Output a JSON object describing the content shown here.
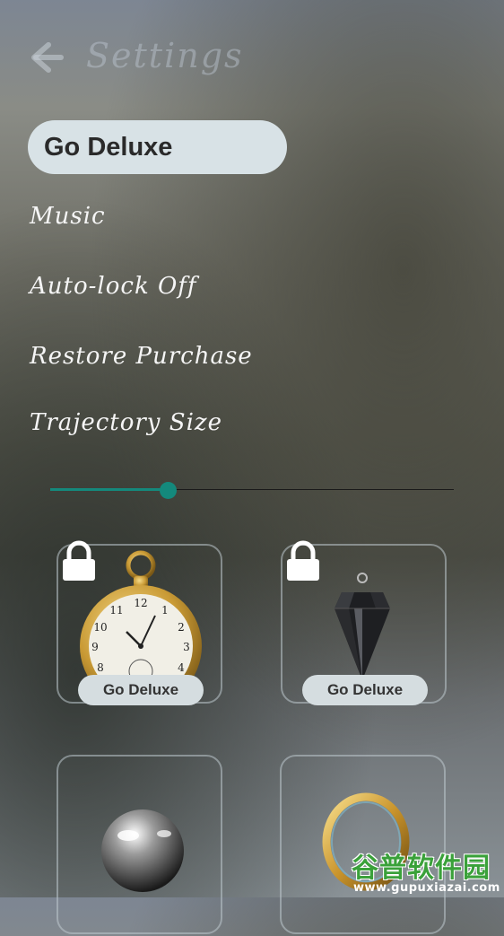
{
  "header": {
    "title": "Settings",
    "back_icon": "arrow-left-icon"
  },
  "deluxe_button": {
    "label": "Go Deluxe"
  },
  "menu": {
    "music": "Music",
    "autolock": "Auto-lock Off",
    "restore": "Restore Purchase",
    "trajectory": "Trajectory Size"
  },
  "slider": {
    "value": 0.29,
    "accent": "#14897c"
  },
  "cards": [
    {
      "name": "pocket-watch",
      "locked": true,
      "badge": "Go Deluxe"
    },
    {
      "name": "crystal-pendulum",
      "locked": true,
      "badge": "Go Deluxe"
    },
    {
      "name": "glass-sphere",
      "locked": false
    },
    {
      "name": "gold-ring",
      "locked": false
    }
  ],
  "watermark": {
    "text": "谷普软件园",
    "url": "www.gupuxiazai.com"
  }
}
